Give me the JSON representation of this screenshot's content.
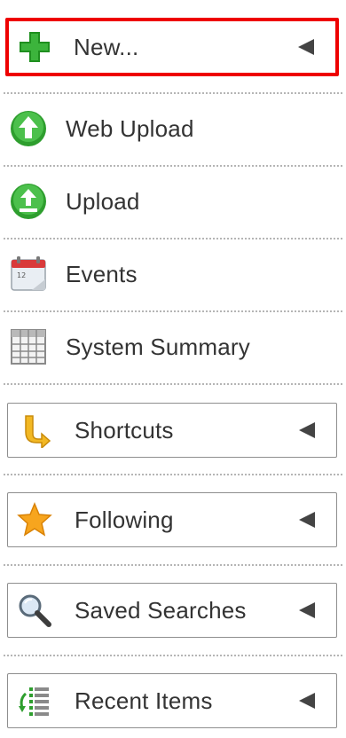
{
  "menu": {
    "new": {
      "label": "New...",
      "icon": "plus-icon"
    },
    "web_upload": {
      "label": "Web Upload",
      "icon": "upload-arrow-icon"
    },
    "upload": {
      "label": "Upload",
      "icon": "upload-icon"
    },
    "events": {
      "label": "Events",
      "icon": "calendar-icon"
    },
    "system_summary": {
      "label": "System Summary",
      "icon": "grid-table-icon"
    },
    "shortcuts": {
      "label": "Shortcuts",
      "icon": "shortcut-arrow-icon"
    },
    "following": {
      "label": "Following",
      "icon": "star-icon"
    },
    "saved_searches": {
      "label": "Saved Searches",
      "icon": "magnifier-icon"
    },
    "recent_items": {
      "label": "Recent Items",
      "icon": "recent-list-icon"
    }
  },
  "colors": {
    "highlight": "#ee0000",
    "green": "#2e9e2e",
    "star": "#f5a623",
    "separator": "#b5b5b5"
  }
}
